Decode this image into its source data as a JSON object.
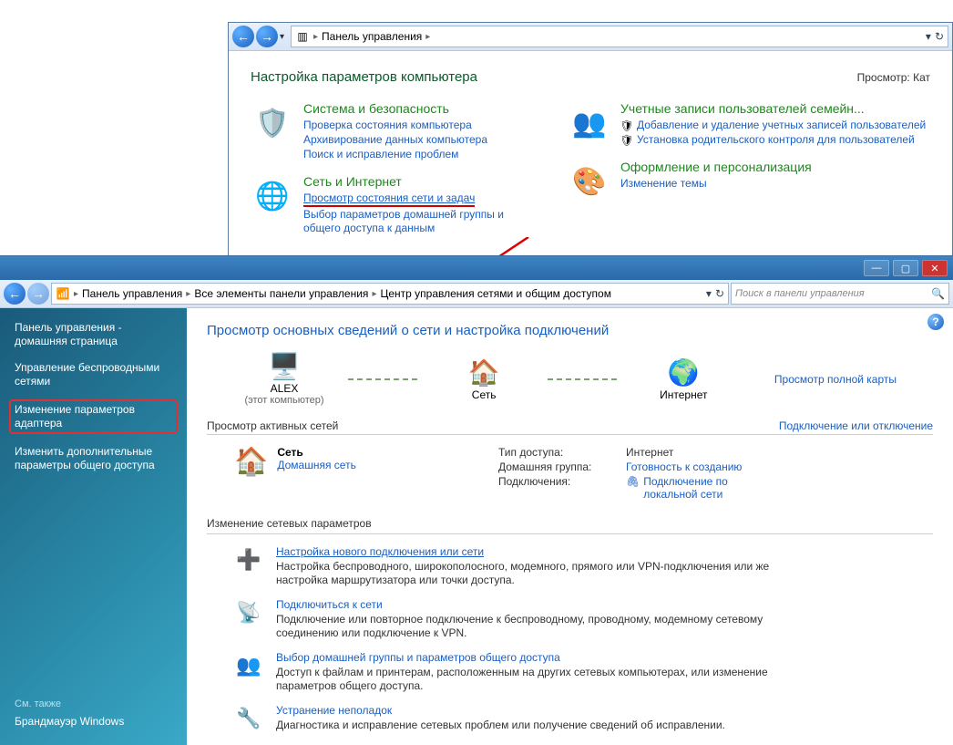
{
  "window1": {
    "breadcrumb": {
      "item1": "Панель управления"
    },
    "title": "Настройка параметров компьютера",
    "view_prefix": "Просмотр:",
    "view_value": "Кат",
    "cat1": {
      "title": "Система и безопасность",
      "l1": "Проверка состояния компьютера",
      "l2": "Архивирование данных компьютера",
      "l3": "Поиск и исправление проблем"
    },
    "cat2": {
      "title": "Сеть и Интернет",
      "l1": "Просмотр состояния сети и задач",
      "l2": "Выбор параметров домашней группы и общего доступа к данным"
    },
    "cat3": {
      "title": "Учетные записи пользователей семейн...",
      "l1": "Добавление и удаление учетных записей пользователей",
      "l2": "Установка родительского контроля для пользователей"
    },
    "cat4": {
      "title": "Оформление и персонализация",
      "l1": "Изменение темы"
    }
  },
  "window2": {
    "breadcrumb": {
      "b1": "Панель управления",
      "b2": "Все элементы панели управления",
      "b3": "Центр управления сетями и общим доступом"
    },
    "search_placeholder": "Поиск в панели управления",
    "sidebar": {
      "home": "Панель управления - домашняя страница",
      "l1": "Управление беспроводными сетями",
      "l2": "Изменение параметров адаптера",
      "l3": "Изменить дополнительные параметры общего доступа",
      "see_also": "См. также",
      "fw": "Брандмауэр Windows"
    },
    "main": {
      "title": "Просмотр основных сведений о сети и настройка подключений",
      "map_full": "Просмотр полной карты",
      "node1_name": "ALEX",
      "node1_sub": "(этот компьютер)",
      "node2_name": "Сеть",
      "node3_name": "Интернет",
      "active_hdr": "Просмотр активных сетей",
      "active_action": "Подключение или отключение",
      "net_name": "Сеть",
      "net_type": "Домашняя сеть",
      "k_access": "Тип доступа:",
      "v_access": "Интернет",
      "k_hg": "Домашняя группа:",
      "v_hg": "Готовность к созданию",
      "k_conn": "Подключения:",
      "v_conn": "Подключение по локальной сети",
      "change_hdr": "Изменение сетевых параметров",
      "t1": "Настройка нового подключения или сети",
      "t1d": "Настройка беспроводного, широкополосного, модемного, прямого или VPN-подключения или же настройка маршрутизатора или точки доступа.",
      "t2": "Подключиться к сети",
      "t2d": "Подключение или повторное подключение к беспроводному, проводному, модемному сетевому соединению или подключение к VPN.",
      "t3": "Выбор домашней группы и параметров общего доступа",
      "t3d": "Доступ к файлам и принтерам, расположенным на других сетевых компьютерах, или изменение параметров общего доступа.",
      "t4": "Устранение неполадок",
      "t4d": "Диагностика и исправление сетевых проблем или получение сведений об исправлении."
    }
  }
}
